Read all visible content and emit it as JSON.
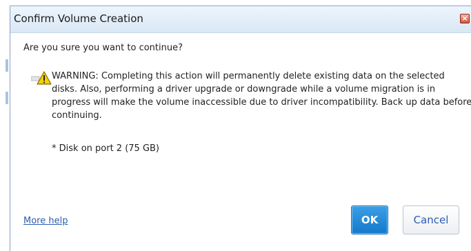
{
  "dialog": {
    "title": "Confirm Volume Creation",
    "close_glyph": "×",
    "question": "Are you sure you want to continue?",
    "warning_icon": "warning-triangle-icon",
    "warning_text": "WARNING: Completing this action will permanently delete existing data on the selected disks. Also, performing a driver upgrade or downgrade while a volume migration is in progress will make the volume inaccessible due to driver incompatibility. Back up data before continuing.",
    "disk_item": "* Disk on port 2 (75 GB)",
    "more_help_label": "More help",
    "ok_label": "OK",
    "cancel_label": "Cancel"
  },
  "colors": {
    "titlebar": "#dce9f6",
    "ok_button": "#1a7fd0",
    "link": "#2a5db0",
    "warning_yellow": "#f5d000"
  }
}
